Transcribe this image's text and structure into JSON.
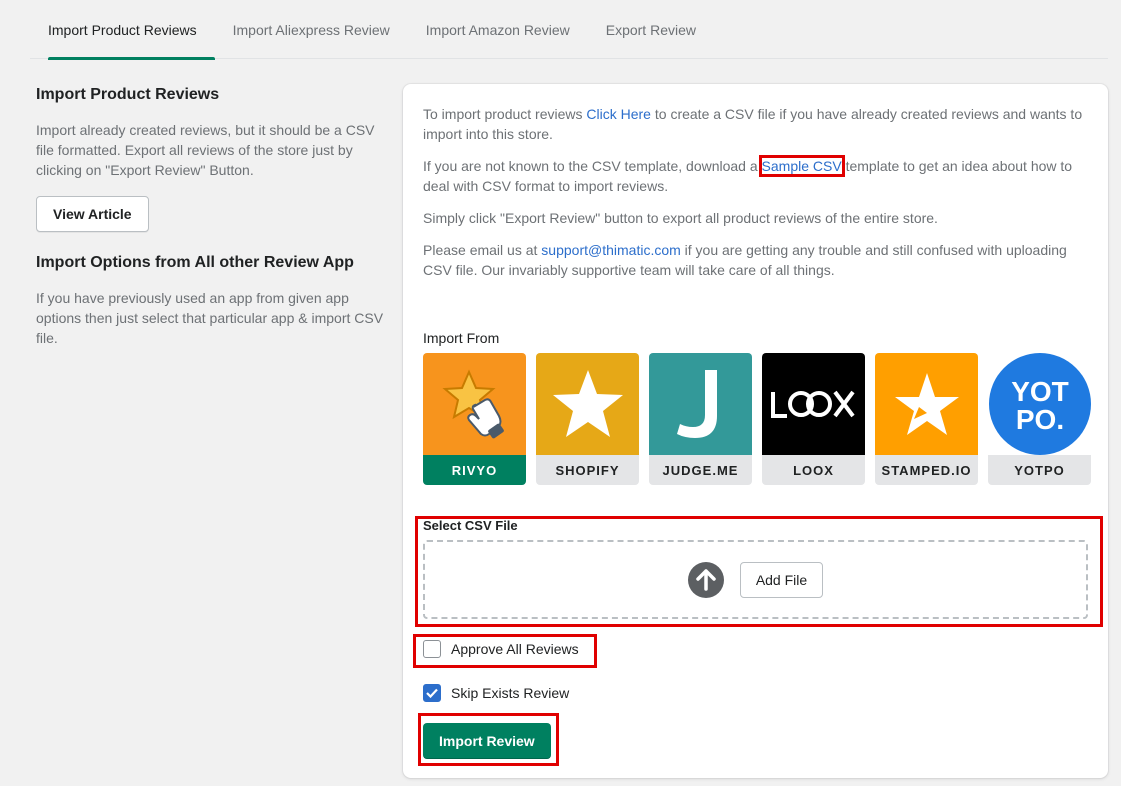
{
  "tabs": [
    "Import Product Reviews",
    "Import Aliexpress Review",
    "Import Amazon Review",
    "Export Review"
  ],
  "left": {
    "title1": "Import Product Reviews",
    "desc1": "Import already created reviews, but it should be a CSV file formatted. Export all reviews of the store just by clicking on \"Export Review\" Button.",
    "view_article": "View Article",
    "title2": "Import Options from All other Review App",
    "desc2": "If you have previously used an app from given app options then just select that particular app & import CSV file."
  },
  "card": {
    "p1_before": "To import product reviews ",
    "p1_link": "Click Here",
    "p1_after": " to create a CSV file if you have already created reviews and wants to import into this store.",
    "p2_before": "If you are not known to the CSV template, download a ",
    "p2_link": "Sample CSV",
    "p2_after": " template to get an idea about how to deal with CSV format to import reviews.",
    "p3": "Simply click \"Export Review\" button to export all product reviews of the entire store.",
    "p4_before": "Please email us at ",
    "p4_link": "support@thimatic.com",
    "p4_after": " if you are getting any trouble and still confused with uploading CSV file. Our invariably supportive team will take care of all things.",
    "import_from": "Import From",
    "apps": [
      {
        "name": "RIVYO",
        "color": "#f7941d",
        "icon": "star-hand-icon"
      },
      {
        "name": "SHOPIFY",
        "color": "#e6a817",
        "icon": "star-icon"
      },
      {
        "name": "JUDGE.ME",
        "color": "#339999",
        "icon": "judgeme-j-icon"
      },
      {
        "name": "LOOX",
        "color": "#000000",
        "logo_text": "LOOX",
        "icon": "loox-logo"
      },
      {
        "name": "STAMPED.IO",
        "color": "#ff9f00",
        "icon": "stamped-star-icon"
      },
      {
        "name": "YOTPO",
        "color": "#1f7ae0",
        "logo_text": "YOT\nPO.",
        "icon": "yotpo-logo"
      }
    ],
    "select_csv": "Select CSV File",
    "add_file": "Add File",
    "approve_all": "Approve All Reviews",
    "skip_exists": "Skip Exists Review",
    "import_review": "Import Review"
  },
  "state": {
    "selected_app": "RIVYO",
    "approve_all_checked": false,
    "skip_exists_checked": true
  },
  "colors": {
    "primary": "#008060",
    "link": "#2c6ecb",
    "highlight": "#e00000"
  }
}
